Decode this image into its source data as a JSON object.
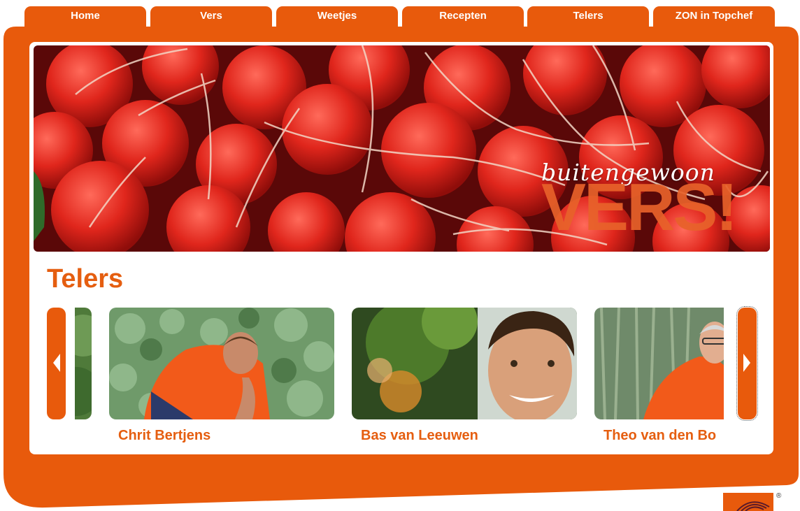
{
  "nav": {
    "tabs": [
      {
        "label": "Home"
      },
      {
        "label": "Vers"
      },
      {
        "label": "Weetjes"
      },
      {
        "label": "Recepten"
      },
      {
        "label": "Telers"
      },
      {
        "label": "ZON in Topchef"
      }
    ]
  },
  "banner": {
    "subtitle": "buitengewoon",
    "title": "VERS!"
  },
  "section": {
    "title": "Telers"
  },
  "carousel": {
    "items": [
      {
        "name": "Chrit Bertjens"
      },
      {
        "name": "Bas van Leeuwen"
      },
      {
        "name": "Theo van den Bo"
      }
    ]
  },
  "logo": {
    "registered_mark": "®"
  },
  "colors": {
    "brand_orange": "#e85a0c",
    "heading_orange": "#e55e10"
  }
}
